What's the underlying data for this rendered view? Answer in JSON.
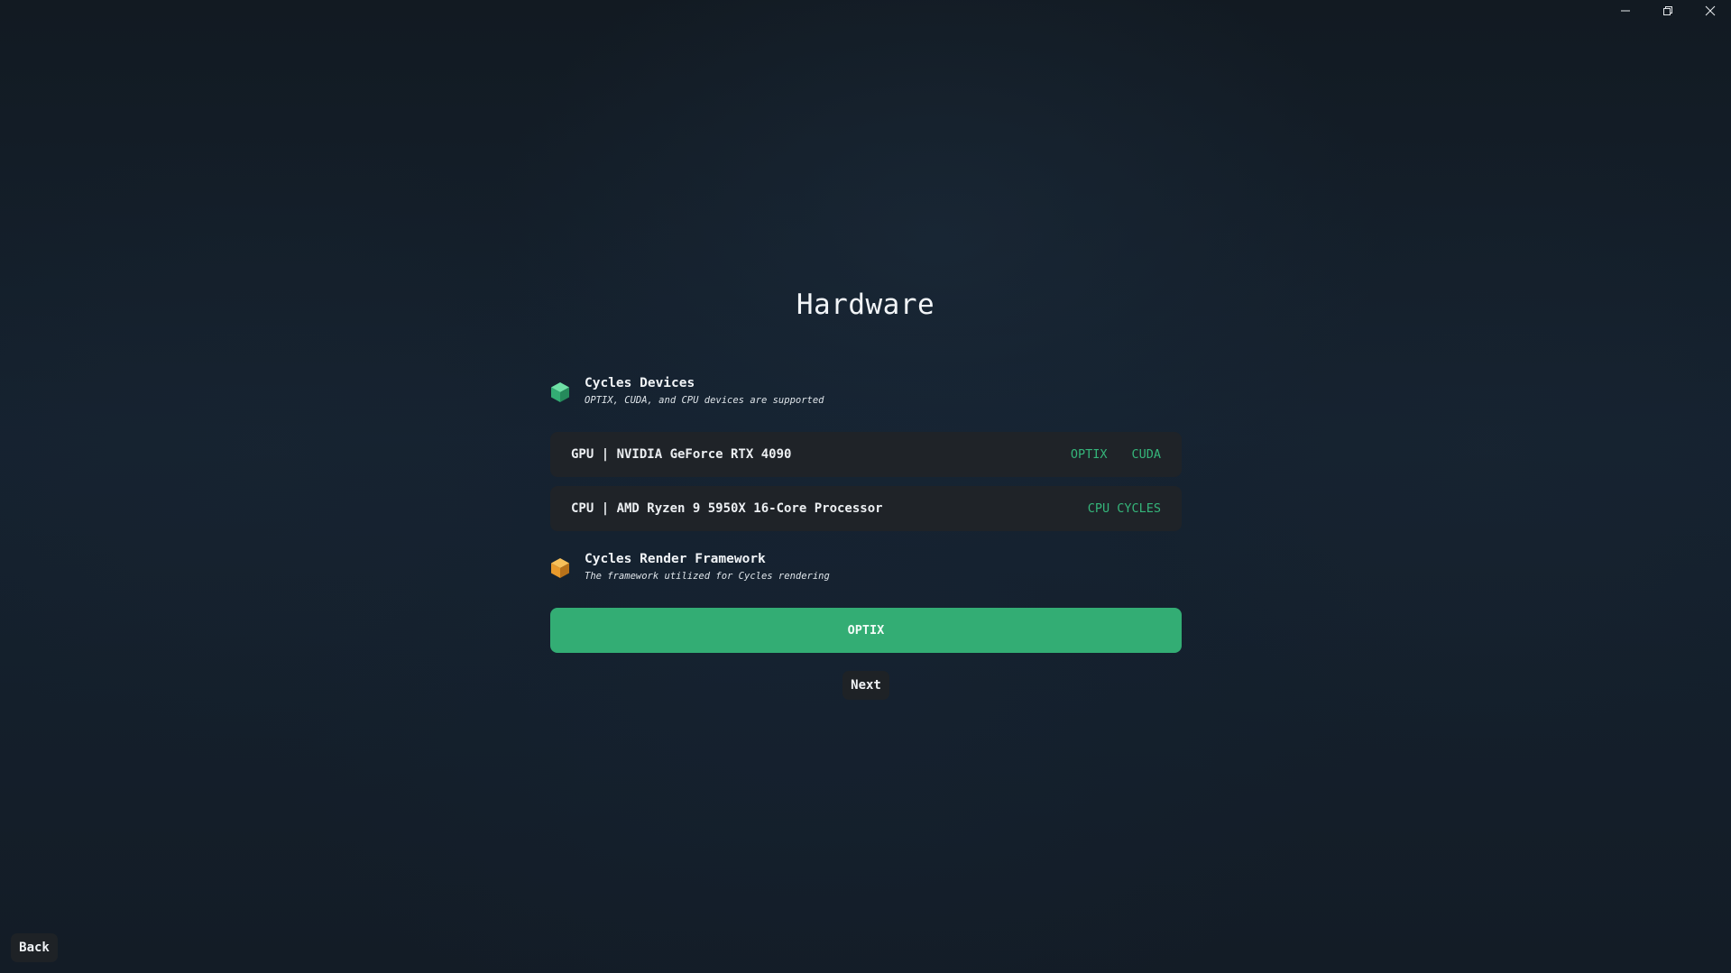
{
  "window": {
    "controls": [
      "minimize-icon",
      "restore-icon",
      "close-icon"
    ]
  },
  "page": {
    "title": "Hardware"
  },
  "devices_section": {
    "title": "Cycles Devices",
    "subtitle": "OPTIX, CUDA, and CPU devices are supported",
    "icon": "cube-icon",
    "icon_color": "#3dbd7d",
    "devices": [
      {
        "name": "GPU | NVIDIA GeForce RTX 4090",
        "tags": [
          "OPTIX",
          "CUDA"
        ]
      },
      {
        "name": "CPU | AMD Ryzen 9 5950X 16-Core Processor",
        "tags": [
          "CPU CYCLES"
        ]
      }
    ]
  },
  "framework_section": {
    "title": "Cycles Render Framework",
    "subtitle": "The framework utilized for Cycles rendering",
    "icon": "cube-icon",
    "icon_color": "#e89a2c",
    "selected": "OPTIX"
  },
  "navigation": {
    "next_label": "Next",
    "back_label": "Back"
  },
  "colors": {
    "accent_green": "#33ad74",
    "tag_green": "#35b57a",
    "row_background": "#1f2328"
  }
}
